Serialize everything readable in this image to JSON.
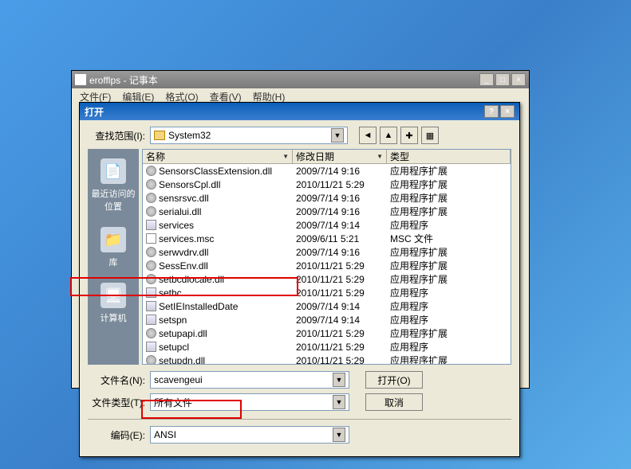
{
  "notepad": {
    "title": "erofflps - 记事本",
    "menu": {
      "file": "文件(F)",
      "edit": "编辑(E)",
      "format": "格式(O)",
      "view": "查看(V)",
      "help": "帮助(H)"
    }
  },
  "dialog": {
    "title": "打开",
    "lookin_label": "查找范围(I):",
    "lookin_value": "System32",
    "sidebar": {
      "recent": "最近访问的位置",
      "library": "库",
      "computer": "计算机"
    },
    "columns": {
      "name": "名称",
      "date": "修改日期",
      "type": "类型"
    },
    "files": [
      {
        "n": "SensorsClassExtension.dll",
        "d": "2009/7/14 9:16",
        "t": "应用程序扩展",
        "i": "gear"
      },
      {
        "n": "SensorsCpl.dll",
        "d": "2010/11/21 5:29",
        "t": "应用程序扩展",
        "i": "gear"
      },
      {
        "n": "sensrsvc.dll",
        "d": "2009/7/14 9:16",
        "t": "应用程序扩展",
        "i": "gear"
      },
      {
        "n": "serialui.dll",
        "d": "2009/7/14 9:16",
        "t": "应用程序扩展",
        "i": "gear"
      },
      {
        "n": "services",
        "d": "2009/7/14 9:14",
        "t": "应用程序",
        "i": "exe"
      },
      {
        "n": "services.msc",
        "d": "2009/6/11 5:21",
        "t": "MSC 文件",
        "i": "doc"
      },
      {
        "n": "serwvdrv.dll",
        "d": "2009/7/14 9:16",
        "t": "应用程序扩展",
        "i": "gear"
      },
      {
        "n": "SessEnv.dll",
        "d": "2010/11/21 5:29",
        "t": "应用程序扩展",
        "i": "gear"
      },
      {
        "n": "setbcdlocale.dll",
        "d": "2010/11/21 5:29",
        "t": "应用程序扩展",
        "i": "gear"
      },
      {
        "n": "sethc",
        "d": "2010/11/21 5:29",
        "t": "应用程序",
        "i": "exe"
      },
      {
        "n": "SetIEInstalledDate",
        "d": "2009/7/14 9:14",
        "t": "应用程序",
        "i": "exe"
      },
      {
        "n": "setspn",
        "d": "2009/7/14 9:14",
        "t": "应用程序",
        "i": "exe"
      },
      {
        "n": "setupapi.dll",
        "d": "2010/11/21 5:29",
        "t": "应用程序扩展",
        "i": "gear"
      },
      {
        "n": "setupcl",
        "d": "2010/11/21 5:29",
        "t": "应用程序",
        "i": "exe"
      },
      {
        "n": "setupdn.dll",
        "d": "2010/11/21 5:29",
        "t": "应用程序扩展",
        "i": "gear"
      }
    ],
    "filename_label": "文件名(N):",
    "filename_value": "scavengeui",
    "filetype_label": "文件类型(T):",
    "filetype_value": "所有文件",
    "encoding_label": "编码(E):",
    "encoding_value": "ANSI",
    "open_btn": "打开(O)",
    "cancel_btn": "取消"
  }
}
